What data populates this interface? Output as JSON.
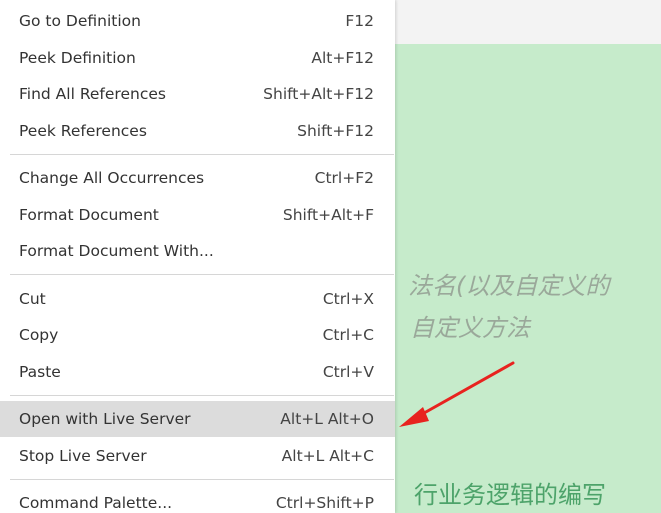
{
  "menu": {
    "groups": [
      [
        {
          "label": "Go to Definition",
          "shortcut": "F12"
        },
        {
          "label": "Peek Definition",
          "shortcut": "Alt+F12"
        },
        {
          "label": "Find All References",
          "shortcut": "Shift+Alt+F12"
        },
        {
          "label": "Peek References",
          "shortcut": "Shift+F12"
        }
      ],
      [
        {
          "label": "Change All Occurrences",
          "shortcut": "Ctrl+F2"
        },
        {
          "label": "Format Document",
          "shortcut": "Shift+Alt+F"
        },
        {
          "label": "Format Document With...",
          "shortcut": ""
        }
      ],
      [
        {
          "label": "Cut",
          "shortcut": "Ctrl+X"
        },
        {
          "label": "Copy",
          "shortcut": "Ctrl+C"
        },
        {
          "label": "Paste",
          "shortcut": "Ctrl+V"
        }
      ],
      [
        {
          "label": "Open with Live Server",
          "shortcut": "Alt+L Alt+O",
          "highlighted": true
        },
        {
          "label": "Stop Live Server",
          "shortcut": "Alt+L Alt+C"
        }
      ],
      [
        {
          "label": "Command Palette...",
          "shortcut": "Ctrl+Shift+P"
        }
      ]
    ]
  },
  "background_text": {
    "line1": "法名(以及自定义的",
    "line2": "自定义方法",
    "line3": "行业务逻辑的编写"
  },
  "colors": {
    "menu_bg": "#ffffff",
    "highlight": "#dcdcdc",
    "editor_green": "#c6ebcb",
    "arrow": "#e8231f"
  },
  "annotation": {
    "icon": "red-arrow-icon"
  }
}
